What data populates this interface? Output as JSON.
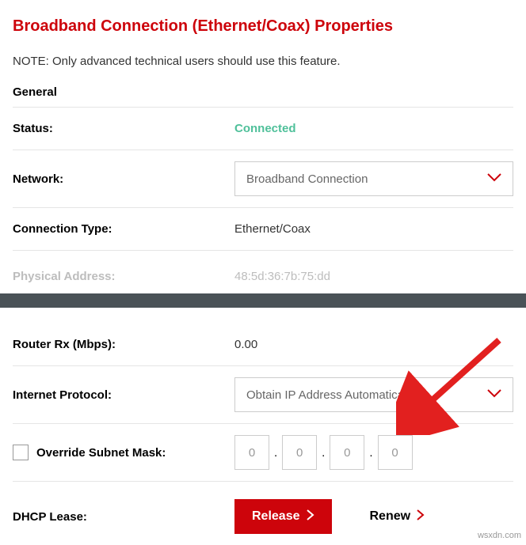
{
  "title": "Broadband Connection (Ethernet/Coax) Properties",
  "note": "NOTE: Only advanced technical users should use this feature.",
  "general": {
    "header": "General",
    "status_label": "Status:",
    "status_value": "Connected",
    "network_label": "Network:",
    "network_select": "Broadband Connection",
    "conn_type_label": "Connection Type:",
    "conn_type_value": "Ethernet/Coax",
    "phys_addr_label": "Physical Address:",
    "phys_addr_value": "48:5d:36:7b:75:dd"
  },
  "lower": {
    "router_rx_label": "Router Rx (Mbps):",
    "router_rx_value": "0.00",
    "ip_label": "Internet Protocol:",
    "ip_select": "Obtain IP Address Automatically",
    "override_label": "Override Subnet Mask:",
    "octets": [
      "0",
      "0",
      "0",
      "0"
    ],
    "dhcp_label": "DHCP Lease:",
    "release_label": "Release",
    "renew_label": "Renew"
  },
  "watermark": "wsxdn.com"
}
